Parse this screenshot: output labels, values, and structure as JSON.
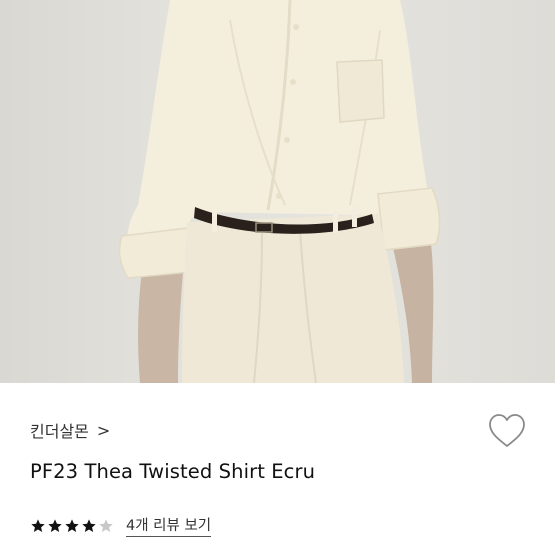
{
  "product": {
    "brand": "킨더살몬",
    "brand_chevron": ">",
    "title": "PF23 Thea Twisted Shirt Ecru",
    "rating": 4,
    "rating_max": 5,
    "reviews_link": "4개 리뷰 보기",
    "wishlisted": false
  },
  "icons": {
    "brand_arrow": "chevron-right-icon",
    "wishlist": "heart-outline-icon",
    "rating": "star-icon"
  },
  "colors": {
    "star_filled": "#111111",
    "star_empty": "#c8c8c8",
    "heart_stroke": "#8a8a8a",
    "photo_background": "#e2e1dc",
    "shirt": "#f3eedc"
  }
}
